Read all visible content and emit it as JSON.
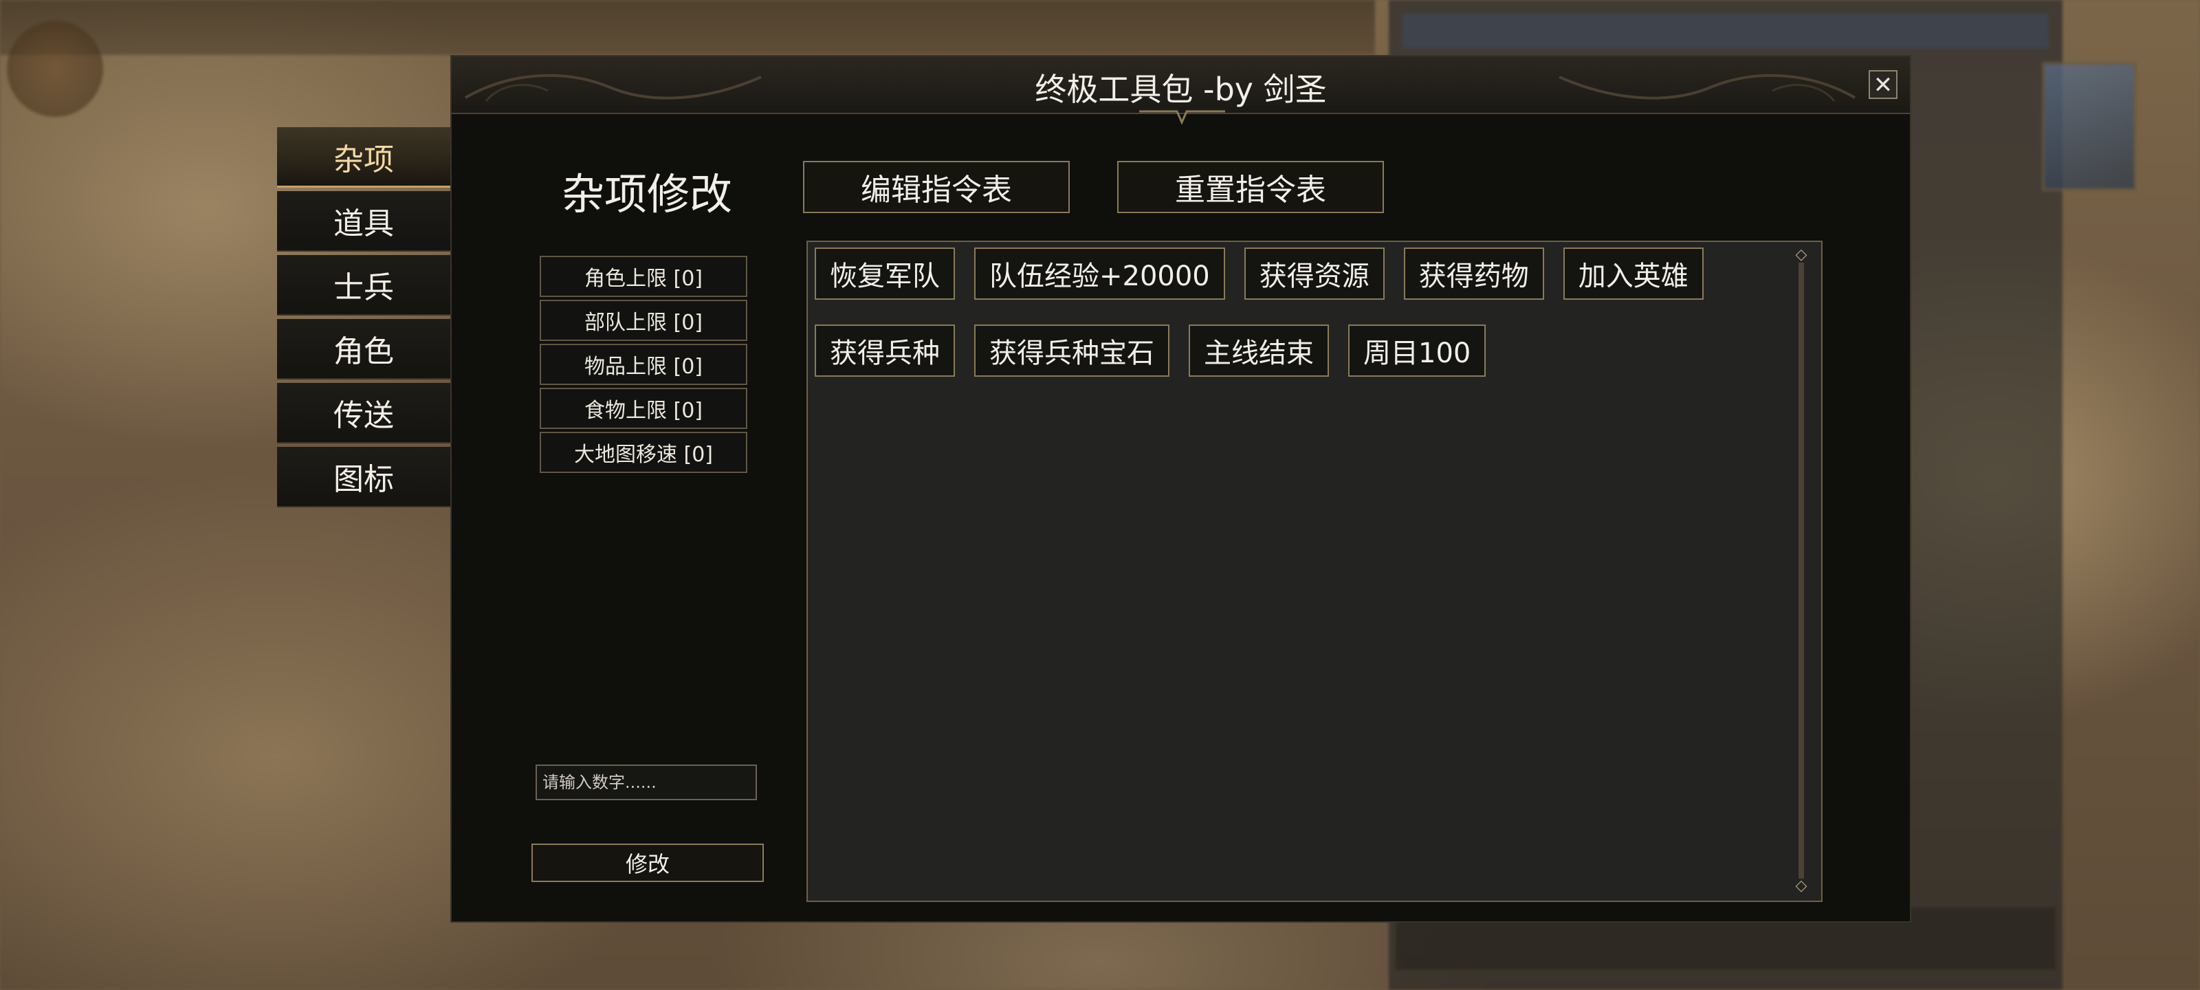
{
  "window": {
    "title": "终极工具包 -by 剑圣",
    "close_glyph": "✕"
  },
  "sidebar": {
    "tabs": [
      {
        "label": "杂项",
        "active": true
      },
      {
        "label": "道具",
        "active": false
      },
      {
        "label": "士兵",
        "active": false
      },
      {
        "label": "角色",
        "active": false
      },
      {
        "label": "传送",
        "active": false
      },
      {
        "label": "图标",
        "active": false
      }
    ]
  },
  "main": {
    "section_title": "杂项修改",
    "edit_commands_label": "编辑指令表",
    "reset_commands_label": "重置指令表",
    "limits": [
      "角色上限 [0]",
      "部队上限 [0]",
      "物品上限 [0]",
      "食物上限 [0]",
      "大地图移速 [0]"
    ],
    "number_input": {
      "value": "",
      "placeholder": "请输入数字......"
    },
    "modify_label": "修改",
    "commands_row1": [
      "恢复军队",
      "队伍经验+20000",
      "获得资源",
      "获得药物",
      "加入英雄"
    ],
    "commands_row2": [
      "获得兵种",
      "获得兵种宝石",
      "主线结束",
      "周目100"
    ],
    "scroll_up_glyph": "◇",
    "scroll_down_glyph": "◇"
  },
  "colors": {
    "accent": "#c9a062",
    "window_bg": "#0f0f0c",
    "panel_bg": "#232321",
    "button_border": "#8a7a58"
  }
}
